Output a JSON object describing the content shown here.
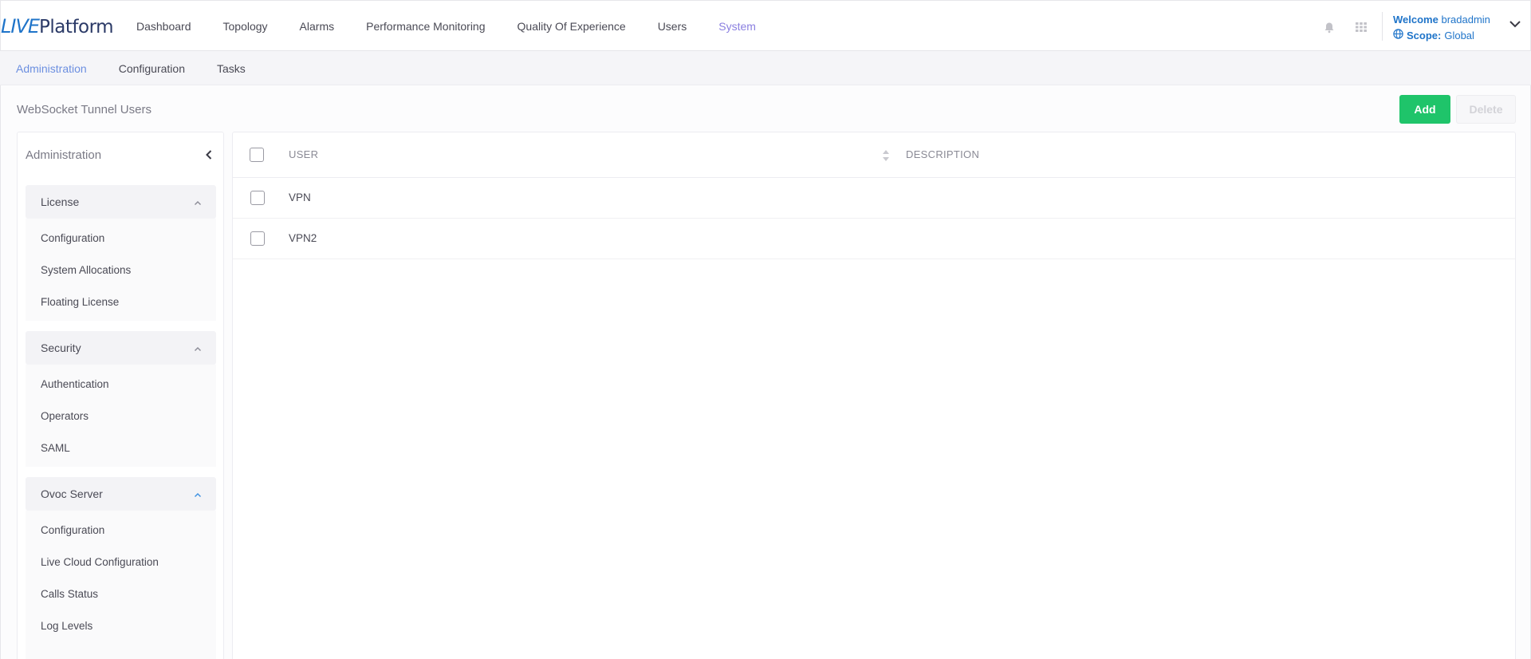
{
  "app": {
    "logo_live": "LIVE",
    "logo_platform": "Platform"
  },
  "topnav": {
    "items": [
      {
        "label": "Dashboard"
      },
      {
        "label": "Topology"
      },
      {
        "label": "Alarms"
      },
      {
        "label": "Performance Monitoring"
      },
      {
        "label": "Quality Of Experience"
      },
      {
        "label": "Users"
      },
      {
        "label": "System",
        "active": true
      }
    ],
    "icons": [
      "bell-icon",
      "grid-apps-icon"
    ]
  },
  "user": {
    "welcome_label": "Welcome",
    "username": "bradadmin",
    "scope_label": "Scope:",
    "scope_value": "Global",
    "icons": [
      "globe-icon",
      "chevron-down-icon"
    ]
  },
  "subnav": {
    "items": [
      {
        "label": "Administration",
        "active": true
      },
      {
        "label": "Configuration"
      },
      {
        "label": "Tasks"
      }
    ]
  },
  "page": {
    "title": "WebSocket Tunnel Users",
    "add_label": "Add",
    "delete_label": "Delete"
  },
  "sidebar": {
    "title": "Administration",
    "sections": [
      {
        "label": "License",
        "items": [
          "Configuration",
          "System Allocations",
          "Floating License"
        ]
      },
      {
        "label": "Security",
        "items": [
          "Authentication",
          "Operators",
          "SAML"
        ]
      },
      {
        "label": "Ovoc Server",
        "items": [
          "Configuration",
          "Live Cloud Configuration",
          "Calls Status",
          "Log Levels"
        ]
      }
    ]
  },
  "table": {
    "columns": [
      "USER",
      "DESCRIPTION"
    ],
    "rows": [
      {
        "user": "VPN",
        "description": ""
      },
      {
        "user": "VPN2",
        "description": ""
      }
    ]
  },
  "colors": {
    "accent_purple": "#8a7fe0",
    "accent_blue": "#1f74c9",
    "add_green": "#1fc46a"
  }
}
